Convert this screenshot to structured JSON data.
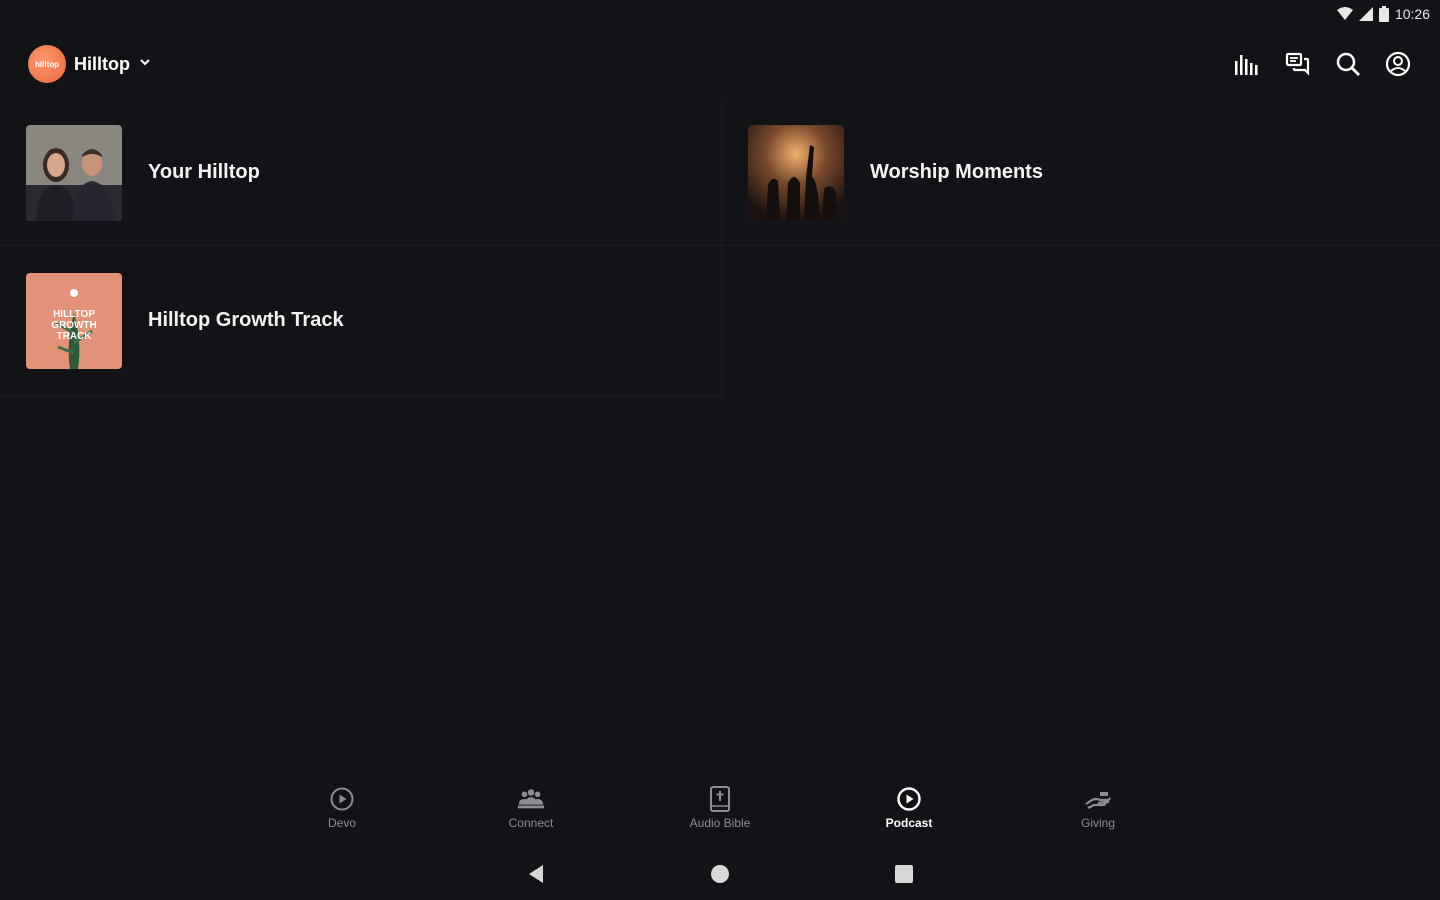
{
  "status_bar": {
    "time": "10:26",
    "icons": [
      "wifi-icon",
      "signal-icon",
      "battery-icon"
    ]
  },
  "header": {
    "org_name": "Hilltop",
    "org_logo_text": "hilltop",
    "actions": [
      "equalizer-icon",
      "chat-icon",
      "search-icon",
      "account-icon"
    ]
  },
  "podcasts": [
    {
      "title": "Your Hilltop",
      "thumb": "couple-photo"
    },
    {
      "title": "Worship Moments",
      "thumb": "worship-photo"
    },
    {
      "title": "Hilltop Growth Track",
      "thumb": "growth-track-art",
      "thumb_text": "HILLTOP GROWTH TRACK"
    }
  ],
  "bottom_nav": [
    {
      "label": "Devo",
      "icon": "play-circle-icon",
      "active": false
    },
    {
      "label": "Connect",
      "icon": "people-icon",
      "active": false
    },
    {
      "label": "Audio Bible",
      "icon": "bible-icon",
      "active": false
    },
    {
      "label": "Podcast",
      "icon": "podcast-icon",
      "active": true
    },
    {
      "label": "Giving",
      "icon": "giving-hand-icon",
      "active": false
    }
  ],
  "colors": {
    "background": "#121316",
    "accent": "#e8643f",
    "inactive": "#8c8d92"
  }
}
